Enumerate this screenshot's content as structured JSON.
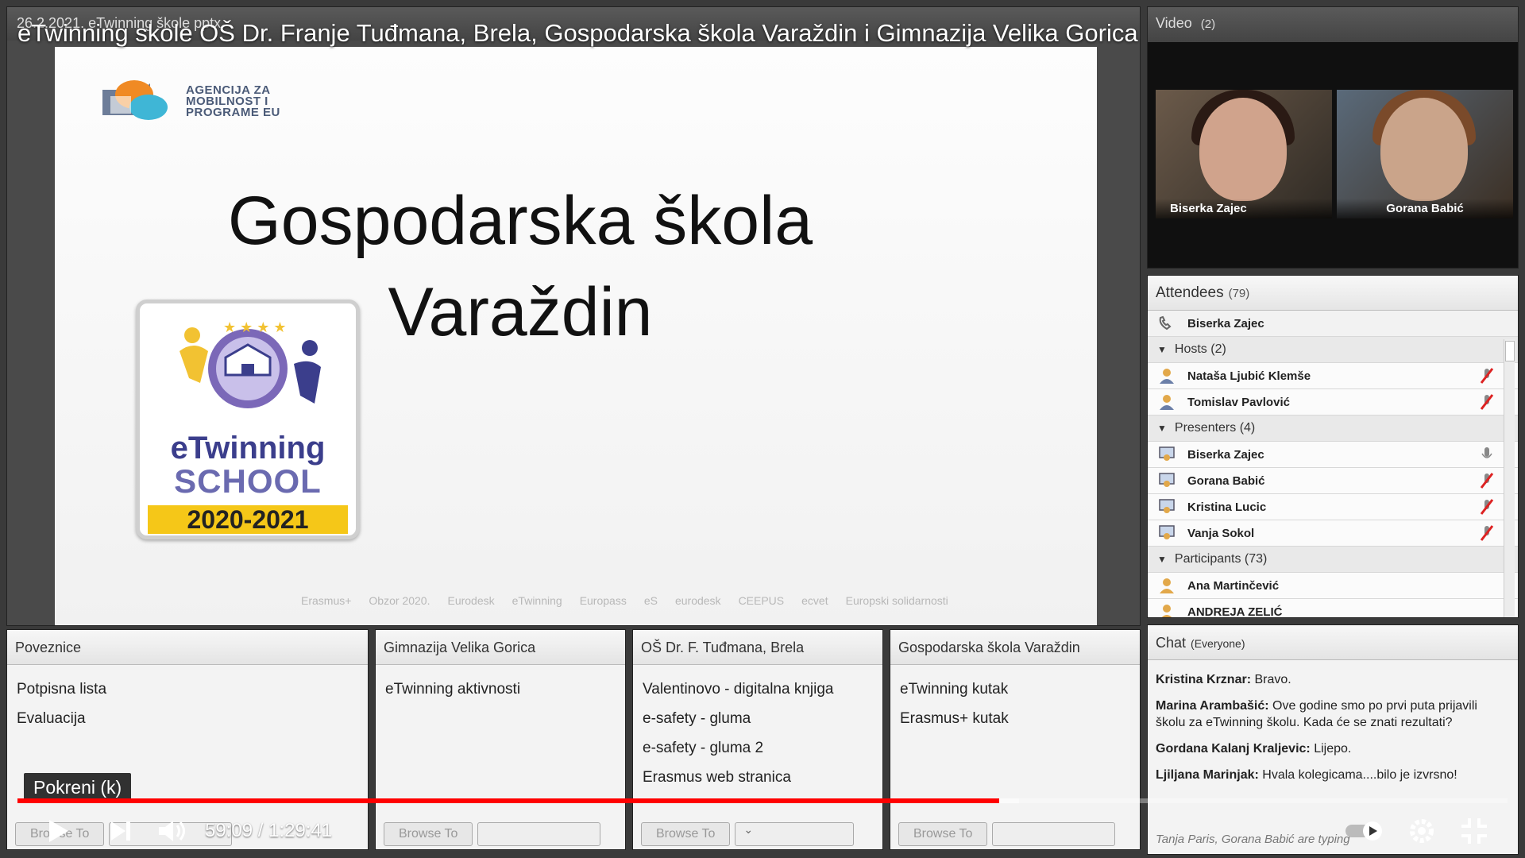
{
  "video": {
    "title": "eTwinning skole OŠ Dr. Franje Tuđmana, Brela, Gospodarska škola Varaždin i Gimnazija Velika Gorica",
    "tooltip": "Pokreni (k)",
    "time_current": "59:09",
    "time_separator": "/",
    "time_total": "1:29:41",
    "played_fraction": 0.659,
    "loaded_fraction": 0.672,
    "icons": [
      "watch-later-icon",
      "share-icon",
      "play-icon",
      "next-icon",
      "volume-icon",
      "autoplay-toggle-icon",
      "settings-icon",
      "exit-fullscreen-icon"
    ]
  },
  "share_pod": {
    "header": "26.2.2021. eTwinning škole pptx",
    "slide": {
      "agency_text": [
        "AGENCIJA ZA",
        "MOBILNOST I",
        "PROGRAME EU"
      ],
      "title_line1": "Gospodarska škola",
      "title_line2": "Varaždin",
      "badge_word": "eTwinning",
      "badge_school": "SCHOOL",
      "badge_year": "2020-2021",
      "footer_logos": [
        "Erasmus+",
        "Obzor 2020.",
        "Eurodesk",
        "eTwinning",
        "Europass",
        "eS",
        "eurodesk",
        "CEEPUS",
        "ecvet",
        "Europski solidarnosti"
      ]
    }
  },
  "video_pod": {
    "header": "Video",
    "count": "(2)",
    "cams": [
      {
        "name": "Biserka Zajec"
      },
      {
        "name": "Gorana Babić"
      }
    ]
  },
  "attendees": {
    "header": "Attendees",
    "count": "(79)",
    "speaking": "Biserka Zajec",
    "groups": [
      {
        "label": "Hosts (2)",
        "members": [
          "Nataša Ljubić Klemše",
          "Tomislav Pavlović"
        ]
      },
      {
        "label": "Presenters (4)",
        "members": [
          "Biserka Zajec",
          "Gorana Babić",
          "Kristina Lucic",
          "Vanja Sokol"
        ]
      },
      {
        "label": "Participants (73)",
        "members": [
          "Ana Martinčević",
          "ANDREJA ZELIĆ"
        ]
      }
    ]
  },
  "link_pods": [
    {
      "header": "Poveznice",
      "links": [
        "Potpisna lista",
        "Evaluacija"
      ],
      "button": "Browse To"
    },
    {
      "header": "Gimnazija Velika Gorica",
      "links": [
        "eTwinning aktivnosti"
      ],
      "button": "Browse To"
    },
    {
      "header": "OŠ Dr. F. Tuđmana, Brela",
      "links": [
        "Valentinovo - digitalna knjiga",
        "e-safety - gluma",
        "e-safety - gluma 2",
        "Erasmus web stranica"
      ],
      "button": "Browse To"
    },
    {
      "header": "Gospodarska škola Varaždin",
      "links": [
        "eTwinning kutak",
        "Erasmus+ kutak"
      ],
      "button": "Browse To"
    }
  ],
  "chat": {
    "header": "Chat",
    "scope": "(Everyone)",
    "messages": [
      {
        "author": "Kristina Krznar:",
        "text": "Bravo."
      },
      {
        "author": "Marina Arambašić:",
        "text": "Ove godine smo po prvi puta prijavili školu za eTwinning školu. Kada će se znati rezultati?"
      },
      {
        "author": "Gordana Kalanj Kraljevic:",
        "text": "Lijepo."
      },
      {
        "author": "Ljiljana Marinjak:",
        "text": "Hvala kolegicama....bilo je izvrsno!"
      }
    ],
    "typing": "Tanja Paris, Gorana Babić are typing"
  },
  "colors": {
    "progress_played": "#ff0000",
    "badge_yellow": "#f5c718",
    "badge_blue": "#3b3e8c"
  }
}
